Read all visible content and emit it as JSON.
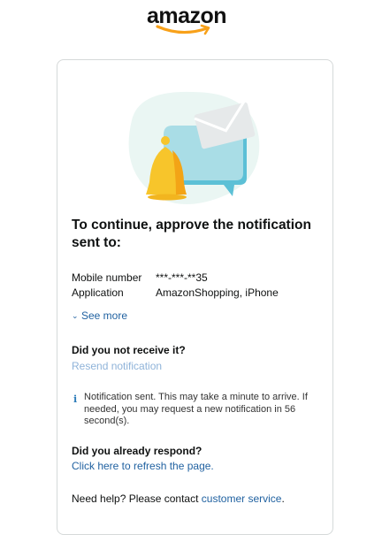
{
  "logo": {
    "text": "amazon",
    "smile_color": "#f8a11a"
  },
  "card": {
    "heading": "To continue, approve the notification sent to:",
    "details": [
      {
        "key": "Mobile number",
        "value": "***-***-**35"
      },
      {
        "key": "Application",
        "value": "AmazonShopping, iPhone"
      }
    ],
    "see_more": "See more",
    "not_received_heading": "Did you not receive it?",
    "resend_link": "Resend notification",
    "info_message": "Notification sent. This may take a minute to arrive. If needed, you may request a new notification in 56 second(s).",
    "already_responded_heading": "Did you already respond?",
    "refresh_link": "Click here to refresh the page.",
    "help_prefix": "Need help? Please contact ",
    "help_link": "customer service",
    "help_suffix": "."
  },
  "icons": {
    "info": "info-icon",
    "chevron": "chevron-down-icon",
    "illustration": [
      "bell-icon",
      "chat-bubble-icon",
      "envelope-icon"
    ]
  },
  "colors": {
    "link": "#2162a1",
    "resend_disabled": "#8fb3d9",
    "bell": "#f7c52b",
    "bubble": "#a9dde6",
    "blob": "#eaf6f3",
    "card_border": "#d5d9d9"
  }
}
